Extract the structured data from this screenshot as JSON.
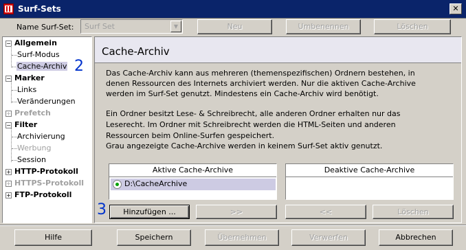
{
  "window": {
    "title": "Surf-Sets",
    "close_glyph": "✕"
  },
  "toolbar": {
    "name_label": "Name Surf-Set:",
    "combo_value": "Surf Set",
    "new_button": "Neu",
    "rename_button": "Umbenennen",
    "delete_button": "Löschen"
  },
  "tree": {
    "allgemein": "Allgemein",
    "surf_modus": "Surf-Modus",
    "cache_archiv": "Cache-Archiv",
    "marker": "Marker",
    "links": "Links",
    "veraenderungen": "Veränderungen",
    "prefetch": "Prefetch",
    "filter": "Filter",
    "archivierung": "Archivierung",
    "werbung": "Werbung",
    "session": "Session",
    "http": "HTTP-Protokoll",
    "https": "HTTPS-Protokoll",
    "ftp": "FTP-Protokoll"
  },
  "panel": {
    "title": "Cache-Archiv",
    "desc1": [
      "Das Cache-Archiv kann aus mehreren (themenspezifischen) Ordnern bestehen, in",
      "denen Ressourcen des Internets archiviert werden. Nur die aktiven Cache-Archive",
      "werden im Surf-Set genutzt. Mindestens ein Cache-Archiv wird benötigt."
    ],
    "desc2": [
      "Ein Ordner besitzt Lese- & Schreibrecht, alle anderen Ordner erhalten nur das",
      "Leserecht. Im Ordner mit Schreibrecht werden die HTML-Seiten und anderen",
      "Ressourcen beim Online-Surfen gespeichert.",
      "Grau angezeigte Cache-Archive werden in keinem Surf-Set aktiv genutzt."
    ],
    "active_header": "Aktive Cache-Archive",
    "inactive_header": "Deaktive Cache-Archive",
    "active_items": [
      "D:\\CacheArchive"
    ],
    "add_button": "Hinzufügen ...",
    "move_right_button": ">>",
    "move_left_button": "<<",
    "remove_button": "Löschen"
  },
  "markers": {
    "m2": "2",
    "m3": "3"
  },
  "footer": {
    "help": "Hilfe",
    "save": "Speichern",
    "apply": "Übernehmen",
    "discard": "Verwerfen",
    "cancel": "Abbrechen"
  }
}
